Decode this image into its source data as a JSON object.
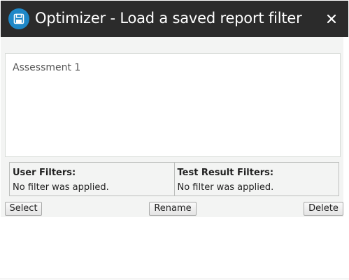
{
  "dialog": {
    "title": "Optimizer - Load a saved report filter",
    "icon": "save-icon",
    "close_icon": "close-icon",
    "accent_color": "#1e88c8",
    "titlebar_color": "#2b2b2b"
  },
  "saved_filters": {
    "items": [
      "Assessment 1"
    ]
  },
  "filters": {
    "user_filters_label": "User Filters:",
    "user_filters_value": "No filter was applied.",
    "test_result_filters_label": "Test Result Filters:",
    "test_result_filters_value": "No filter was applied."
  },
  "buttons": {
    "select_label": "Select",
    "rename_label": "Rename",
    "delete_label": "Delete"
  }
}
